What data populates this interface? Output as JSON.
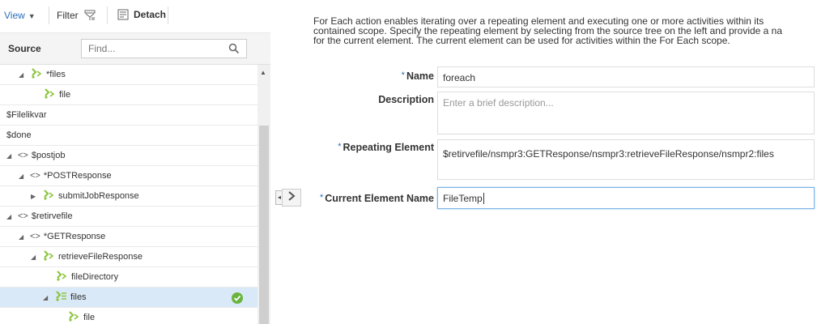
{
  "toolbar": {
    "view_label": "View",
    "filter_label": "Filter",
    "detach_label": "Detach"
  },
  "source": {
    "label": "Source",
    "search_placeholder": "Find..."
  },
  "tree": {
    "rows": [
      {
        "label": "*files",
        "indent": 1,
        "toggle": "expanded",
        "icon": "element-icon"
      },
      {
        "label": "file",
        "indent": 3,
        "toggle": "none",
        "icon": "element-icon"
      },
      {
        "label": "$Filelikvar",
        "indent": 0,
        "toggle": "none",
        "icon": "none"
      },
      {
        "label": "$done",
        "indent": 0,
        "toggle": "none",
        "icon": "none"
      },
      {
        "label": "$postjob",
        "indent": 0,
        "toggle": "expanded",
        "icon": "angle-icon"
      },
      {
        "label": "*POSTResponse",
        "indent": 1,
        "toggle": "expanded",
        "icon": "angle-icon"
      },
      {
        "label": "submitJobResponse",
        "indent": 2,
        "toggle": "collapsed",
        "icon": "element-icon"
      },
      {
        "label": "$retirvefile",
        "indent": 0,
        "toggle": "expanded",
        "icon": "angle-icon"
      },
      {
        "label": "*GETResponse",
        "indent": 1,
        "toggle": "expanded",
        "icon": "angle-icon"
      },
      {
        "label": "retrieveFileResponse",
        "indent": 2,
        "toggle": "expanded",
        "icon": "element-icon"
      },
      {
        "label": "fileDirectory",
        "indent": 4,
        "toggle": "none",
        "icon": "element-icon"
      },
      {
        "label": "files",
        "indent": 3,
        "toggle": "expanded",
        "icon": "repeating-element-icon",
        "selected": true
      },
      {
        "label": "file",
        "indent": 5,
        "toggle": "none",
        "icon": "element-icon"
      }
    ]
  },
  "description": {
    "line1": "For Each action enables iterating over a repeating element and executing one or more activities within its",
    "line2": "contained scope. Specify the repeating element by selecting from the source tree on the left and provide a na",
    "line3": "for the current element. The current element can be used for activities within the For Each scope."
  },
  "form": {
    "required_mark": "*",
    "name_label": "Name",
    "name_value": "foreach",
    "description_label": "Description",
    "description_placeholder": "Enter a brief description...",
    "repeating_label": "Repeating Element",
    "repeating_value": "$retirvefile/nsmpr3:GETResponse/nsmpr3:retrieveFileResponse/nsmpr2:files",
    "current_label": "Current Element Name",
    "current_value": "FileTemp"
  },
  "colors": {
    "accent": "#2a6ebb",
    "selected_row": "#d9e9f7",
    "element_icon_green": "#8cc63f",
    "check_green": "#6ab43e"
  }
}
